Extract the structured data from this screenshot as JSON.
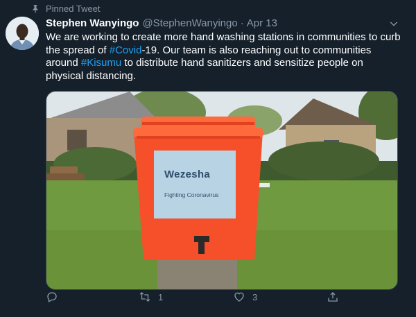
{
  "pinned": {
    "label": "Pinned Tweet",
    "icon": "pin-icon"
  },
  "author": {
    "display_name": "Stephen Wanyingo",
    "handle": "@StephenWanyingo",
    "separator": "·",
    "date": "Apr 13"
  },
  "tweet": {
    "text_1": "We are working to create more hand washing stations in communities to curb the spread of ",
    "hashtag_1": "#Covid",
    "text_2": "-19. Our team is also reaching out to communities around ",
    "hashtag_2": "#Kisumu",
    "text_3": " to distribute hand sanitizers and sensitize people on physical distancing."
  },
  "media": {
    "bucket_brand": "Wezesha",
    "bucket_subtitle": "Fighting Coronavirus"
  },
  "actions": {
    "reply_count": "",
    "retweet_count": "1",
    "like_count": "3"
  },
  "colors": {
    "background": "#15202b",
    "muted": "#8899a6",
    "link": "#1da1f2",
    "bucket": "#f6502a"
  }
}
